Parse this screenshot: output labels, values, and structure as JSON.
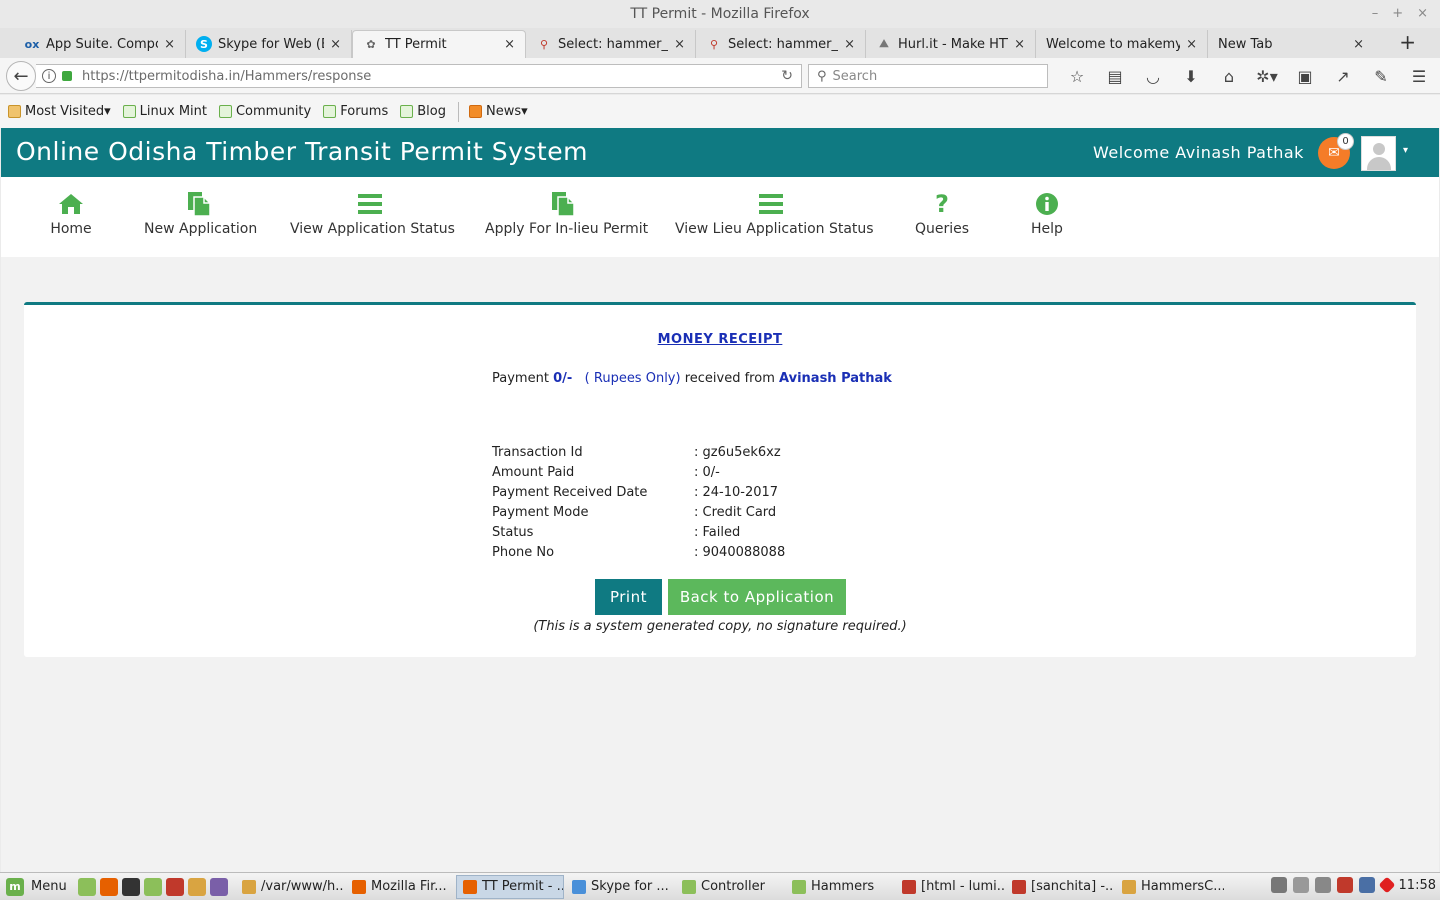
{
  "window": {
    "title": "TT Permit - Mozilla Firefox",
    "controls": [
      "–",
      "+",
      "×"
    ]
  },
  "tabs": [
    {
      "title": "App Suite. Compose",
      "icon": "ox-icon"
    },
    {
      "title": "Skype for Web (Beta",
      "icon": "skype-icon"
    },
    {
      "title": "TT Permit",
      "icon": "ttpermit-icon",
      "active": true
    },
    {
      "title": "Select: hammer_reg",
      "icon": "database-icon"
    },
    {
      "title": "Select: hammer_reg",
      "icon": "database-icon"
    },
    {
      "title": "Hurl.it - Make HTTP r",
      "icon": "hurl-icon"
    },
    {
      "title": "Welcome to makemyrep",
      "icon": ""
    },
    {
      "title": "New Tab",
      "icon": ""
    }
  ],
  "tab_close": "×",
  "new_tab": "+",
  "navbar": {
    "url_host": "https://ttpermitodisha.in",
    "url_path": "/Hammers/response",
    "search_placeholder": "Search"
  },
  "bookmarks": [
    {
      "label": "Most Visited",
      "icon": "folder-icon",
      "dropdown": true
    },
    {
      "label": "Linux Mint",
      "icon": "mint-icon"
    },
    {
      "label": "Community",
      "icon": "mint-icon"
    },
    {
      "label": "Forums",
      "icon": "mint-icon"
    },
    {
      "label": "Blog",
      "icon": "mint-icon"
    },
    {
      "label": "News",
      "icon": "rss-icon",
      "dropdown": true
    }
  ],
  "site": {
    "title": "Online Odisha Timber Transit Permit System",
    "welcome": "Welcome Avinash Pathak",
    "notification_count": "0",
    "accent": "#0f7a82",
    "menu_green": "#4caf50"
  },
  "menu": [
    {
      "label": "Home",
      "icon": "home-icon"
    },
    {
      "label": "New Application",
      "icon": "document-icon"
    },
    {
      "label": "View Application Status",
      "icon": "list-icon"
    },
    {
      "label": "Apply For In-lieu Permit",
      "icon": "document-icon"
    },
    {
      "label": "View Lieu Application Status",
      "icon": "list-icon"
    },
    {
      "label": "Queries",
      "icon": "question-icon"
    },
    {
      "label": "Help",
      "icon": "info-icon"
    }
  ],
  "receipt": {
    "title": "MONEY RECEIPT",
    "pay_prefix": "Payment",
    "amount": "0/-",
    "rupees_words": "( Rupees Only)",
    "received_from": "received from",
    "payer": "Avinash Pathak",
    "details": [
      {
        "label": "Transaction Id",
        "value": ": gz6u5ek6xz"
      },
      {
        "label": "Amount Paid",
        "value": ": 0/-"
      },
      {
        "label": "Payment Received Date",
        "value": ": 24-10-2017"
      },
      {
        "label": "Payment Mode",
        "value": ": Credit Card"
      },
      {
        "label": "Status",
        "value": ": Failed"
      },
      {
        "label": "Phone No",
        "value": ": 9040088088"
      }
    ],
    "print_label": "Print",
    "back_label": "Back to Application",
    "note": "(This is a system generated copy, no signature required.)"
  },
  "taskbar": {
    "menu_label": "Menu",
    "tasks": [
      {
        "label": "/var/www/h...",
        "color": "#d9a441"
      },
      {
        "label": "Mozilla Fir...",
        "color": "#e66000"
      },
      {
        "label": "TT Permit - ...",
        "color": "#e66000",
        "active": true
      },
      {
        "label": "Skype for ...",
        "color": "#4a90d9"
      },
      {
        "label": "Controller",
        "color": "#8cbf5a"
      },
      {
        "label": "Hammers",
        "color": "#8cbf5a"
      },
      {
        "label": "[html - lumi...",
        "color": "#c0392b"
      },
      {
        "label": "[sanchita] -...",
        "color": "#c0392b"
      },
      {
        "label": "HammersC...",
        "color": "#d9a441"
      }
    ],
    "clock": "11:58"
  }
}
